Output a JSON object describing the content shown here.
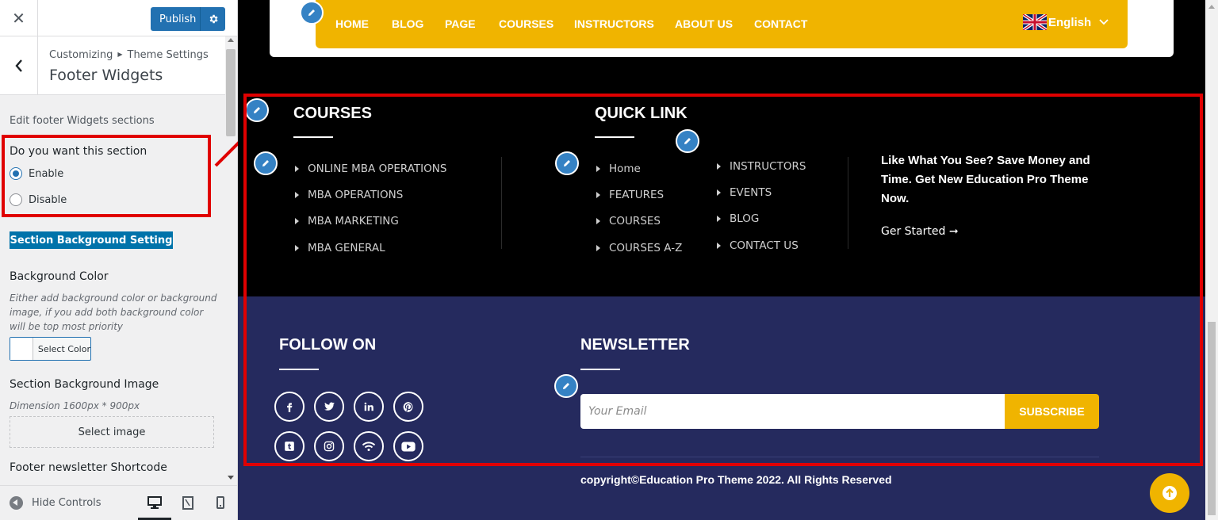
{
  "customizer": {
    "publish_label": "Publish",
    "breadcrumb_root": "Customizing",
    "breadcrumb_parent": "Theme Settings",
    "section_title": "Footer Widgets",
    "description": "Edit footer Widgets sections",
    "toggle_label": "Do you want this section",
    "enable_label": "Enable",
    "disable_label": "Disable",
    "selected": "Enable",
    "bg_setting_button": "Section Background Setting",
    "bg_color_label": "Background Color",
    "bg_color_help": "Either add background color or background image, if you add both background color will be top most priority",
    "select_color_label": "Select Color",
    "bg_image_label": "Section Background Image",
    "bg_image_dimension": "Dimension 1600px * 900px",
    "select_image_label": "Select image",
    "newsletter_shortcode_label": "Footer newsletter Shortcode",
    "hide_controls_label": "Hide Controls"
  },
  "preview": {
    "nav": {
      "items": [
        "HOME",
        "BLOG",
        "PAGE",
        "COURSES",
        "INSTRUCTORS",
        "ABOUT US",
        "CONTACT"
      ],
      "language": "English"
    },
    "courses": {
      "heading": "COURSES",
      "links": [
        "ONLINE MBA OPERATIONS",
        "MBA OPERATIONS",
        "MBA MARKETING",
        "MBA GENERAL"
      ]
    },
    "quick_link": {
      "heading": "QUICK LINK",
      "col1": [
        "Home",
        "FEATURES",
        "COURSES",
        "COURSES A-Z"
      ],
      "col2": [
        "INSTRUCTORS",
        "EVENTS",
        "BLOG",
        "CONTACT US"
      ]
    },
    "promo": {
      "text": "Like What You See? Save Money and Time. Get New Education Pro Theme Now.",
      "cta": "Ger Started ➞"
    },
    "follow": {
      "heading": "FOLLOW ON",
      "icons": [
        "facebook-icon",
        "twitter-icon",
        "linkedin-icon",
        "pinterest-icon",
        "tumblr-icon",
        "instagram-icon",
        "rss-icon",
        "youtube-icon"
      ]
    },
    "newsletter": {
      "heading": "NEWSLETTER",
      "placeholder": "Your Email",
      "button": "SUBSCRIBE"
    },
    "copyright": "copyright©Education Pro Theme 2022. All Rights Reserved"
  },
  "colors": {
    "accent_yellow": "#f0b400",
    "footer_bottom_bg": "#252a5e",
    "wp_blue": "#2271b1",
    "highlight_red": "#e00000"
  }
}
